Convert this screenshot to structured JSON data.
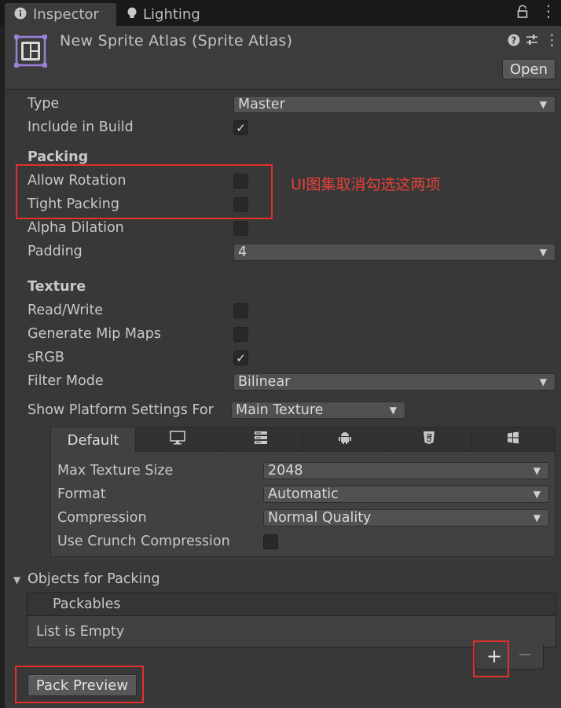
{
  "tabs": [
    {
      "label": "Inspector",
      "icon": "info-icon"
    },
    {
      "label": "Lighting",
      "icon": "bulb-icon"
    }
  ],
  "header": {
    "title": "New Sprite Atlas (Sprite Atlas)",
    "open_label": "Open"
  },
  "fields": {
    "type_label": "Type",
    "type_value": "Master",
    "include_label": "Include in Build",
    "packing_section": "Packing",
    "allow_rotation_label": "Allow Rotation",
    "tight_packing_label": "Tight Packing",
    "alpha_dilation_label": "Alpha Dilation",
    "padding_label": "Padding",
    "padding_value": "4",
    "texture_section": "Texture",
    "read_write_label": "Read/Write",
    "mipmaps_label": "Generate Mip Maps",
    "srgb_label": "sRGB",
    "filter_label": "Filter Mode",
    "filter_value": "Bilinear",
    "platform_label": "Show Platform Settings For",
    "platform_value": "Main Texture"
  },
  "checkbox_state": {
    "include_in_build": true,
    "allow_rotation": false,
    "tight_packing": false,
    "alpha_dilation": false,
    "read_write": false,
    "generate_mip_maps": false,
    "srgb": true,
    "use_crunch": false
  },
  "annotation": "UI图集取消勾选这两项",
  "platform_tabs": {
    "default_label": "Default",
    "icons": [
      "monitor-icon",
      "server-icon",
      "android-icon",
      "html5-icon",
      "windows-icon"
    ]
  },
  "platform_settings": {
    "max_size_label": "Max Texture Size",
    "max_size_value": "2048",
    "format_label": "Format",
    "format_value": "Automatic",
    "compression_label": "Compression",
    "compression_value": "Normal Quality",
    "crunch_label": "Use Crunch Compression"
  },
  "objects": {
    "section_label": "Objects for Packing",
    "list_header": "Packables",
    "empty_text": "List is Empty",
    "add_symbol": "+",
    "remove_symbol": "−"
  },
  "pack_preview_label": "Pack Preview",
  "colors": {
    "background": "#383838",
    "highlight_red": "#e0312b"
  }
}
